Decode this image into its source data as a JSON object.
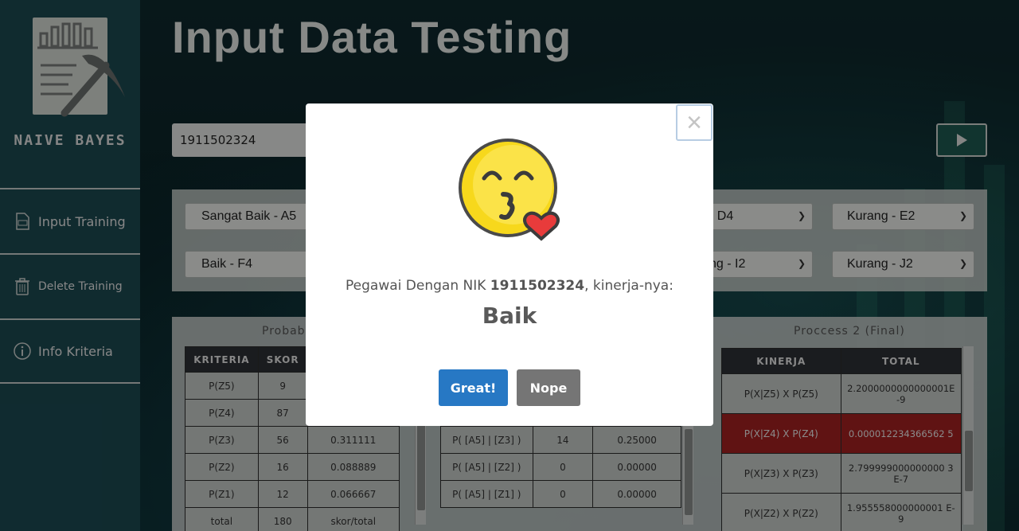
{
  "sidebar": {
    "logo_title": "NAIVE BAYES",
    "items": [
      {
        "label": "Input Training",
        "icon": "csv-file-icon"
      },
      {
        "label": "Delete Training",
        "icon": "trash-icon"
      },
      {
        "label": "Info Kriteria",
        "icon": "info-icon"
      }
    ]
  },
  "page": {
    "title": "Input Data Testing",
    "nik_value": "1911502324"
  },
  "selects": {
    "row1": [
      "Sangat Baik - A5",
      "- D4",
      "Kurang - E2"
    ],
    "row2": [
      "Baik - F4",
      "ng - I2",
      "Kurang - J2"
    ]
  },
  "prob_table": {
    "title": "Probab",
    "headers": [
      "KRITERIA",
      "SKOR",
      ""
    ],
    "rows": [
      [
        "P(Z5)",
        "9",
        ""
      ],
      [
        "P(Z4)",
        "87",
        ""
      ],
      [
        "P(Z3)",
        "56",
        "0.311111"
      ],
      [
        "P(Z2)",
        "16",
        "0.088889"
      ],
      [
        "P(Z1)",
        "12",
        "0.066667"
      ],
      [
        "total",
        "180",
        "skor/total"
      ]
    ]
  },
  "process1_table": {
    "rows": [
      [
        "P( [A5] | [Z3] )",
        "14",
        "0.25000"
      ],
      [
        "P( [A5] | [Z2] )",
        "0",
        "0.00000"
      ],
      [
        "P( [A5] | [Z1] )",
        "0",
        "0.00000"
      ]
    ]
  },
  "process2_table": {
    "title": "Proccess 2 (Final)",
    "headers": [
      "KINERJA",
      "TOTAL"
    ],
    "rows": [
      [
        "P(X|Z5) X P(Z5)",
        "2.2000000000000001E-9"
      ],
      [
        "P(X|Z4) X P(Z4)",
        "0.000012234366562 5"
      ],
      [
        "P(X|Z3) X P(Z3)",
        "2.799999000000000 3E-7"
      ],
      [
        "P(X|Z2) X P(Z2)",
        "1.955558000000001 E-9"
      ]
    ]
  },
  "modal": {
    "message_prefix": "Pegawai Dengan NIK",
    "nik": "1911502324",
    "message_suffix": ", kinerja-nya:",
    "result": "Baik",
    "confirm_label": "Great!",
    "cancel_label": "Nope",
    "close_glyph": "×",
    "icon": "kissing-face-heart-icon"
  },
  "colors": {
    "sidebar": "#1c4a52",
    "confirm": "#2778c4",
    "cancel": "#757575",
    "highlight_row": "#a52222"
  }
}
